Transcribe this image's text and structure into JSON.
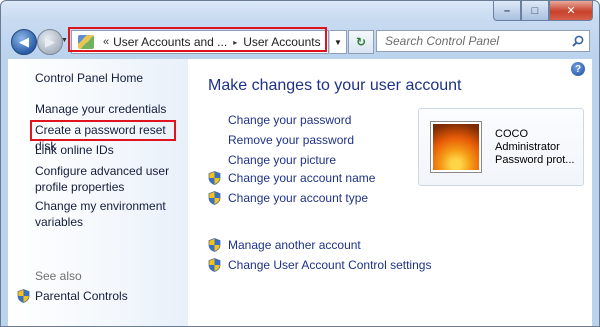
{
  "titlebar": {
    "minimize_label": "–",
    "maximize_label": "□",
    "close_label": "✕"
  },
  "nav": {
    "back_icon": "back-arrow-icon",
    "forward_icon": "forward-arrow-icon",
    "breadcrumb": {
      "prefix": "«",
      "parent": "User Accounts and ...",
      "separator": "▸",
      "current": "User Accounts"
    },
    "search_placeholder": "Search Control Panel"
  },
  "sidebar": {
    "home": "Control Panel Home",
    "items": [
      "Manage your credentials",
      "Create a password reset disk",
      "Link online IDs",
      "Configure advanced user profile properties",
      "Change my environment variables"
    ],
    "see_also": "See also",
    "parental": "Parental Controls"
  },
  "main": {
    "title": "Make changes to your user account",
    "links": [
      "Change your password",
      "Remove your password",
      "Change your picture",
      "Change your account name",
      "Change your account type",
      "Manage another account",
      "Change User Account Control settings"
    ],
    "help_label": "?"
  },
  "user": {
    "name": "COCO",
    "role": "Administrator",
    "status": "Password prot..."
  },
  "colors": {
    "highlight": "#e0141e",
    "link": "#1e3287"
  }
}
